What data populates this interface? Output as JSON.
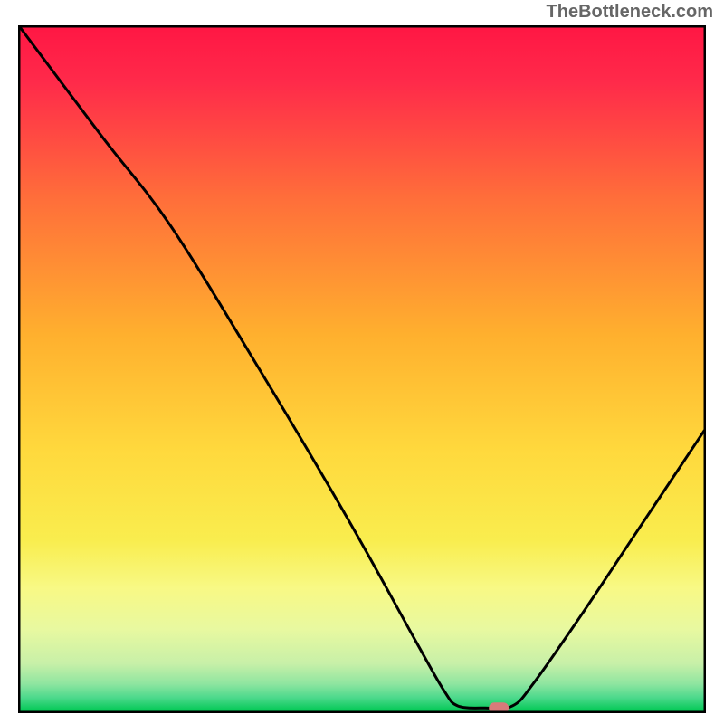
{
  "watermark": "TheBottleneck.com",
  "chart_data": {
    "type": "line",
    "title": "",
    "xlabel": "",
    "ylabel": "",
    "xlim": [
      0,
      100
    ],
    "ylim": [
      0,
      100
    ],
    "gradient_stops": [
      {
        "offset": 0,
        "color": "#ff1744"
      },
      {
        "offset": 8,
        "color": "#ff2a4a"
      },
      {
        "offset": 25,
        "color": "#ff6e3a"
      },
      {
        "offset": 45,
        "color": "#ffb02e"
      },
      {
        "offset": 62,
        "color": "#ffd93d"
      },
      {
        "offset": 75,
        "color": "#f9ed4e"
      },
      {
        "offset": 82,
        "color": "#f8f985"
      },
      {
        "offset": 88,
        "color": "#e8f9a0"
      },
      {
        "offset": 93,
        "color": "#c8f0a8"
      },
      {
        "offset": 96,
        "color": "#8ee5a0"
      },
      {
        "offset": 98,
        "color": "#4cd98c"
      },
      {
        "offset": 100,
        "color": "#00c853"
      }
    ],
    "curve": [
      {
        "x": 0,
        "y": 100
      },
      {
        "x": 12,
        "y": 84
      },
      {
        "x": 22,
        "y": 71
      },
      {
        "x": 35,
        "y": 50
      },
      {
        "x": 48,
        "y": 28
      },
      {
        "x": 58,
        "y": 10
      },
      {
        "x": 62,
        "y": 3
      },
      {
        "x": 64,
        "y": 0.8
      },
      {
        "x": 68,
        "y": 0.5
      },
      {
        "x": 72,
        "y": 0.8
      },
      {
        "x": 75,
        "y": 4
      },
      {
        "x": 82,
        "y": 14
      },
      {
        "x": 90,
        "y": 26
      },
      {
        "x": 100,
        "y": 41
      }
    ],
    "marker": {
      "x": 70,
      "y": 0.5,
      "color": "#d87a7a"
    },
    "border_color": "#000000",
    "curve_color": "#000000"
  }
}
